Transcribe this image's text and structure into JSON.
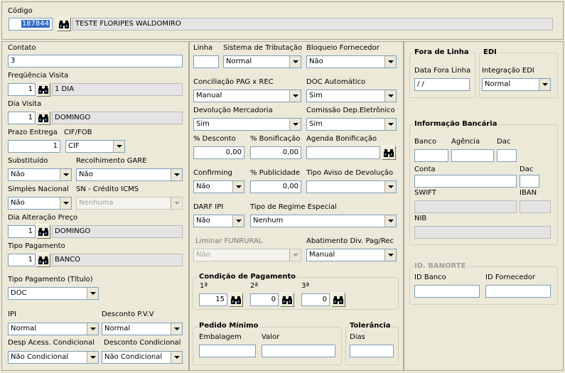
{
  "top": {
    "codigo_label": "Código",
    "codigo_value": "187844",
    "nome_value": "TESTE FLORIPES WALDOMIRO"
  },
  "left": {
    "contato_label": "Contato",
    "contato_value": "3",
    "freq_label": "Freqüência Visita",
    "freq_num": "1",
    "freq_desc": "1 DIA",
    "dia_label": "Dia Visita",
    "dia_num": "1",
    "dia_desc": "DOMINGO",
    "prazo_label": "Prazo Entrega",
    "prazo_value": "1",
    "ciffob_label": "CIF/FOB",
    "ciffob_value": "CIF",
    "substituido_label": "Substituído",
    "substituido_value": "Não",
    "gare_label": "Recolhimento GARE",
    "gare_value": "Não",
    "simples_label": "Simples Nacional",
    "simples_value": "Não",
    "sn_label": "SN - Crédito ICMS",
    "sn_value": "Nenhuma",
    "dia_alt_label": "Dia Alteração Preço",
    "dia_alt_num": "1",
    "dia_alt_desc": "DOMINGO",
    "tipo_pag_label": "Tipo Pagamento",
    "tipo_pag_num": "1",
    "tipo_pag_desc": "BANCO",
    "tipo_pag_titulo_label": "Tipo Pagamento (Título)",
    "tipo_pag_titulo_value": "DOC",
    "ipi_label": "IPI",
    "ipi_value": "Normal",
    "desc_pvv_label": "Desconto P.V.V",
    "desc_pvv_value": "Normal",
    "desp_label": "Desp Acess. Condicional",
    "desp_value": "Não Condicional",
    "desc_cond_label": "Desconto Condicional",
    "desc_cond_value": "Não Condicional"
  },
  "middle": {
    "linha_label": "Linha",
    "linha_value": "",
    "sist_trib_label": "Sistema de Tributação",
    "sist_trib_value": "Normal",
    "bloq_label": "Bloqueio Fornecedor",
    "bloq_value": "Não",
    "concil_label": "Conciliação PAG x REC",
    "concil_value": "Manual",
    "doc_auto_label": "DOC Automático",
    "doc_auto_value": "Sim",
    "devol_label": "Devolução Mercadoria",
    "devol_value": "Sim",
    "comissao_label": "Comissão Dep.Eletrônico",
    "comissao_value": "Sim",
    "pct_desc_label": "% Desconto",
    "pct_desc_value": "0,00",
    "pct_bonif_label": "% Bonificação",
    "pct_bonif_value": "0,00",
    "agenda_label": "Agenda Bonificação",
    "agenda_value": "",
    "confirming_label": "Confirming",
    "confirming_value": "Não",
    "pct_public_label": "% Publicidade",
    "pct_public_value": "0,00",
    "aviso_label": "Tipo Aviso de Devolução",
    "aviso_value": "",
    "darf_label": "DARF IPI",
    "darf_value": "Não",
    "regime_label": "Tipo de Regime Especial",
    "regime_value": "Nenhum",
    "liminar_label": "Liminar FUNRURAL",
    "liminar_value": "Não",
    "abat_label": "Abatimento Div. Pag/Rec",
    "abat_value": "Manual",
    "cond_pag_title": "Condição de Pagamento",
    "cond1_label": "1ª",
    "cond1_value": "15",
    "cond2_label": "2ª",
    "cond2_value": "0",
    "cond3_label": "3ª",
    "cond3_value": "0",
    "pedido_title": "Pedido Mínimo",
    "embalagem_label": "Embalagem",
    "embalagem_value": "",
    "valor_label": "Valor",
    "valor_value": "",
    "toler_title": "Tolerância",
    "dias_label": "Dias",
    "dias_value": ""
  },
  "right": {
    "fora_title": "Fora de Linha",
    "data_fora_label": "Data Fora Linha",
    "data_fora_value": " / /",
    "edi_title": "EDI",
    "integ_label": "Integração EDI",
    "integ_value": "Normal",
    "banco_title": "Informação Bancária",
    "banco_label": "Banco",
    "agencia_label": "Agência",
    "dac_label": "Dac",
    "conta_label": "Conta",
    "dac2_label": "Dac",
    "swift_label": "SWIFT",
    "iban_label": "IBAN",
    "nib_label": "NIB",
    "banorte_title": "ID. BANORTE",
    "id_banco_label": "ID Banco",
    "id_fornec_label": "ID Fornecedor"
  }
}
